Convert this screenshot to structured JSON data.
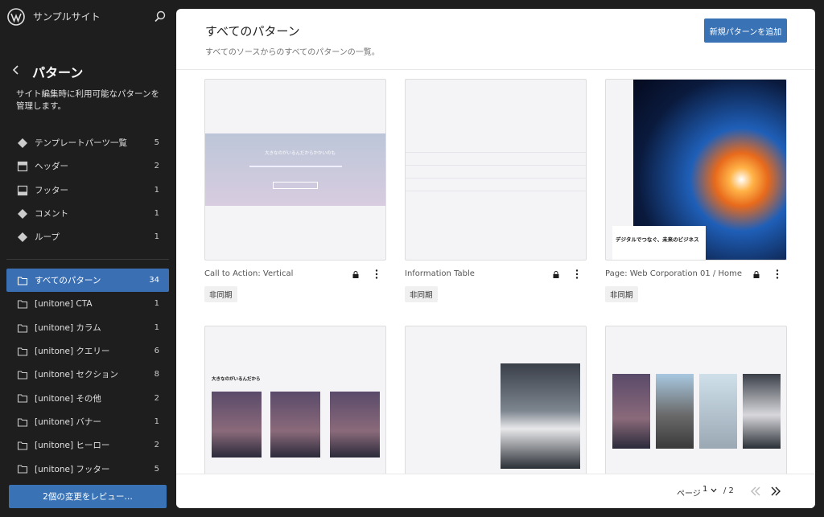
{
  "site": {
    "title": "サンプルサイト"
  },
  "sidebar": {
    "section_title": "パターン",
    "description": "サイト編集時に利用可能なパターンを管理します。",
    "top_items": [
      {
        "icon": "diamond-icon",
        "label": "テンプレートパーツ一覧",
        "count": "5"
      },
      {
        "icon": "header-icon",
        "label": "ヘッダー",
        "count": "2"
      },
      {
        "icon": "footer-icon",
        "label": "フッター",
        "count": "1"
      },
      {
        "icon": "diamond-icon",
        "label": "コメント",
        "count": "1"
      },
      {
        "icon": "diamond-icon",
        "label": "ループ",
        "count": "1"
      }
    ],
    "categories": [
      {
        "label": "すべてのパターン",
        "count": "34",
        "active": true
      },
      {
        "label": "[unitone] CTA",
        "count": "1"
      },
      {
        "label": "[unitone] カラム",
        "count": "1"
      },
      {
        "label": "[unitone] クエリー",
        "count": "6"
      },
      {
        "label": "[unitone] セクション",
        "count": "8"
      },
      {
        "label": "[unitone] その他",
        "count": "2"
      },
      {
        "label": "[unitone] バナー",
        "count": "1"
      },
      {
        "label": "[unitone] ヒーロー",
        "count": "2"
      },
      {
        "label": "[unitone] フッター",
        "count": "5"
      }
    ],
    "review_button": "2個の変更をレビュー…"
  },
  "main": {
    "title": "すべてのパターン",
    "description": "すべてのソースからのすべてのパターンの一覧。",
    "add_button": "新規パターンを追加",
    "cards": [
      {
        "title": "Call to Action: Vertical",
        "badge": "非同期",
        "preview_text": "大きなのがいるんだからかかいのも"
      },
      {
        "title": "Information Table",
        "badge": "非同期"
      },
      {
        "title": "Page: Web Corporation 01 / Home",
        "badge": "非同期",
        "preview_text": "デジタルでつなぐ、未来のビジネス"
      },
      {
        "title": "",
        "badge": "",
        "preview_text": "大きなのがいるんだから"
      },
      {
        "title": "",
        "badge": ""
      },
      {
        "title": "",
        "badge": ""
      }
    ],
    "pagination": {
      "label": "ページ",
      "current": "1",
      "total": "/ 2"
    }
  },
  "colors": {
    "accent": "#3a73b5",
    "sidebar_bg": "#1e1e1e"
  }
}
